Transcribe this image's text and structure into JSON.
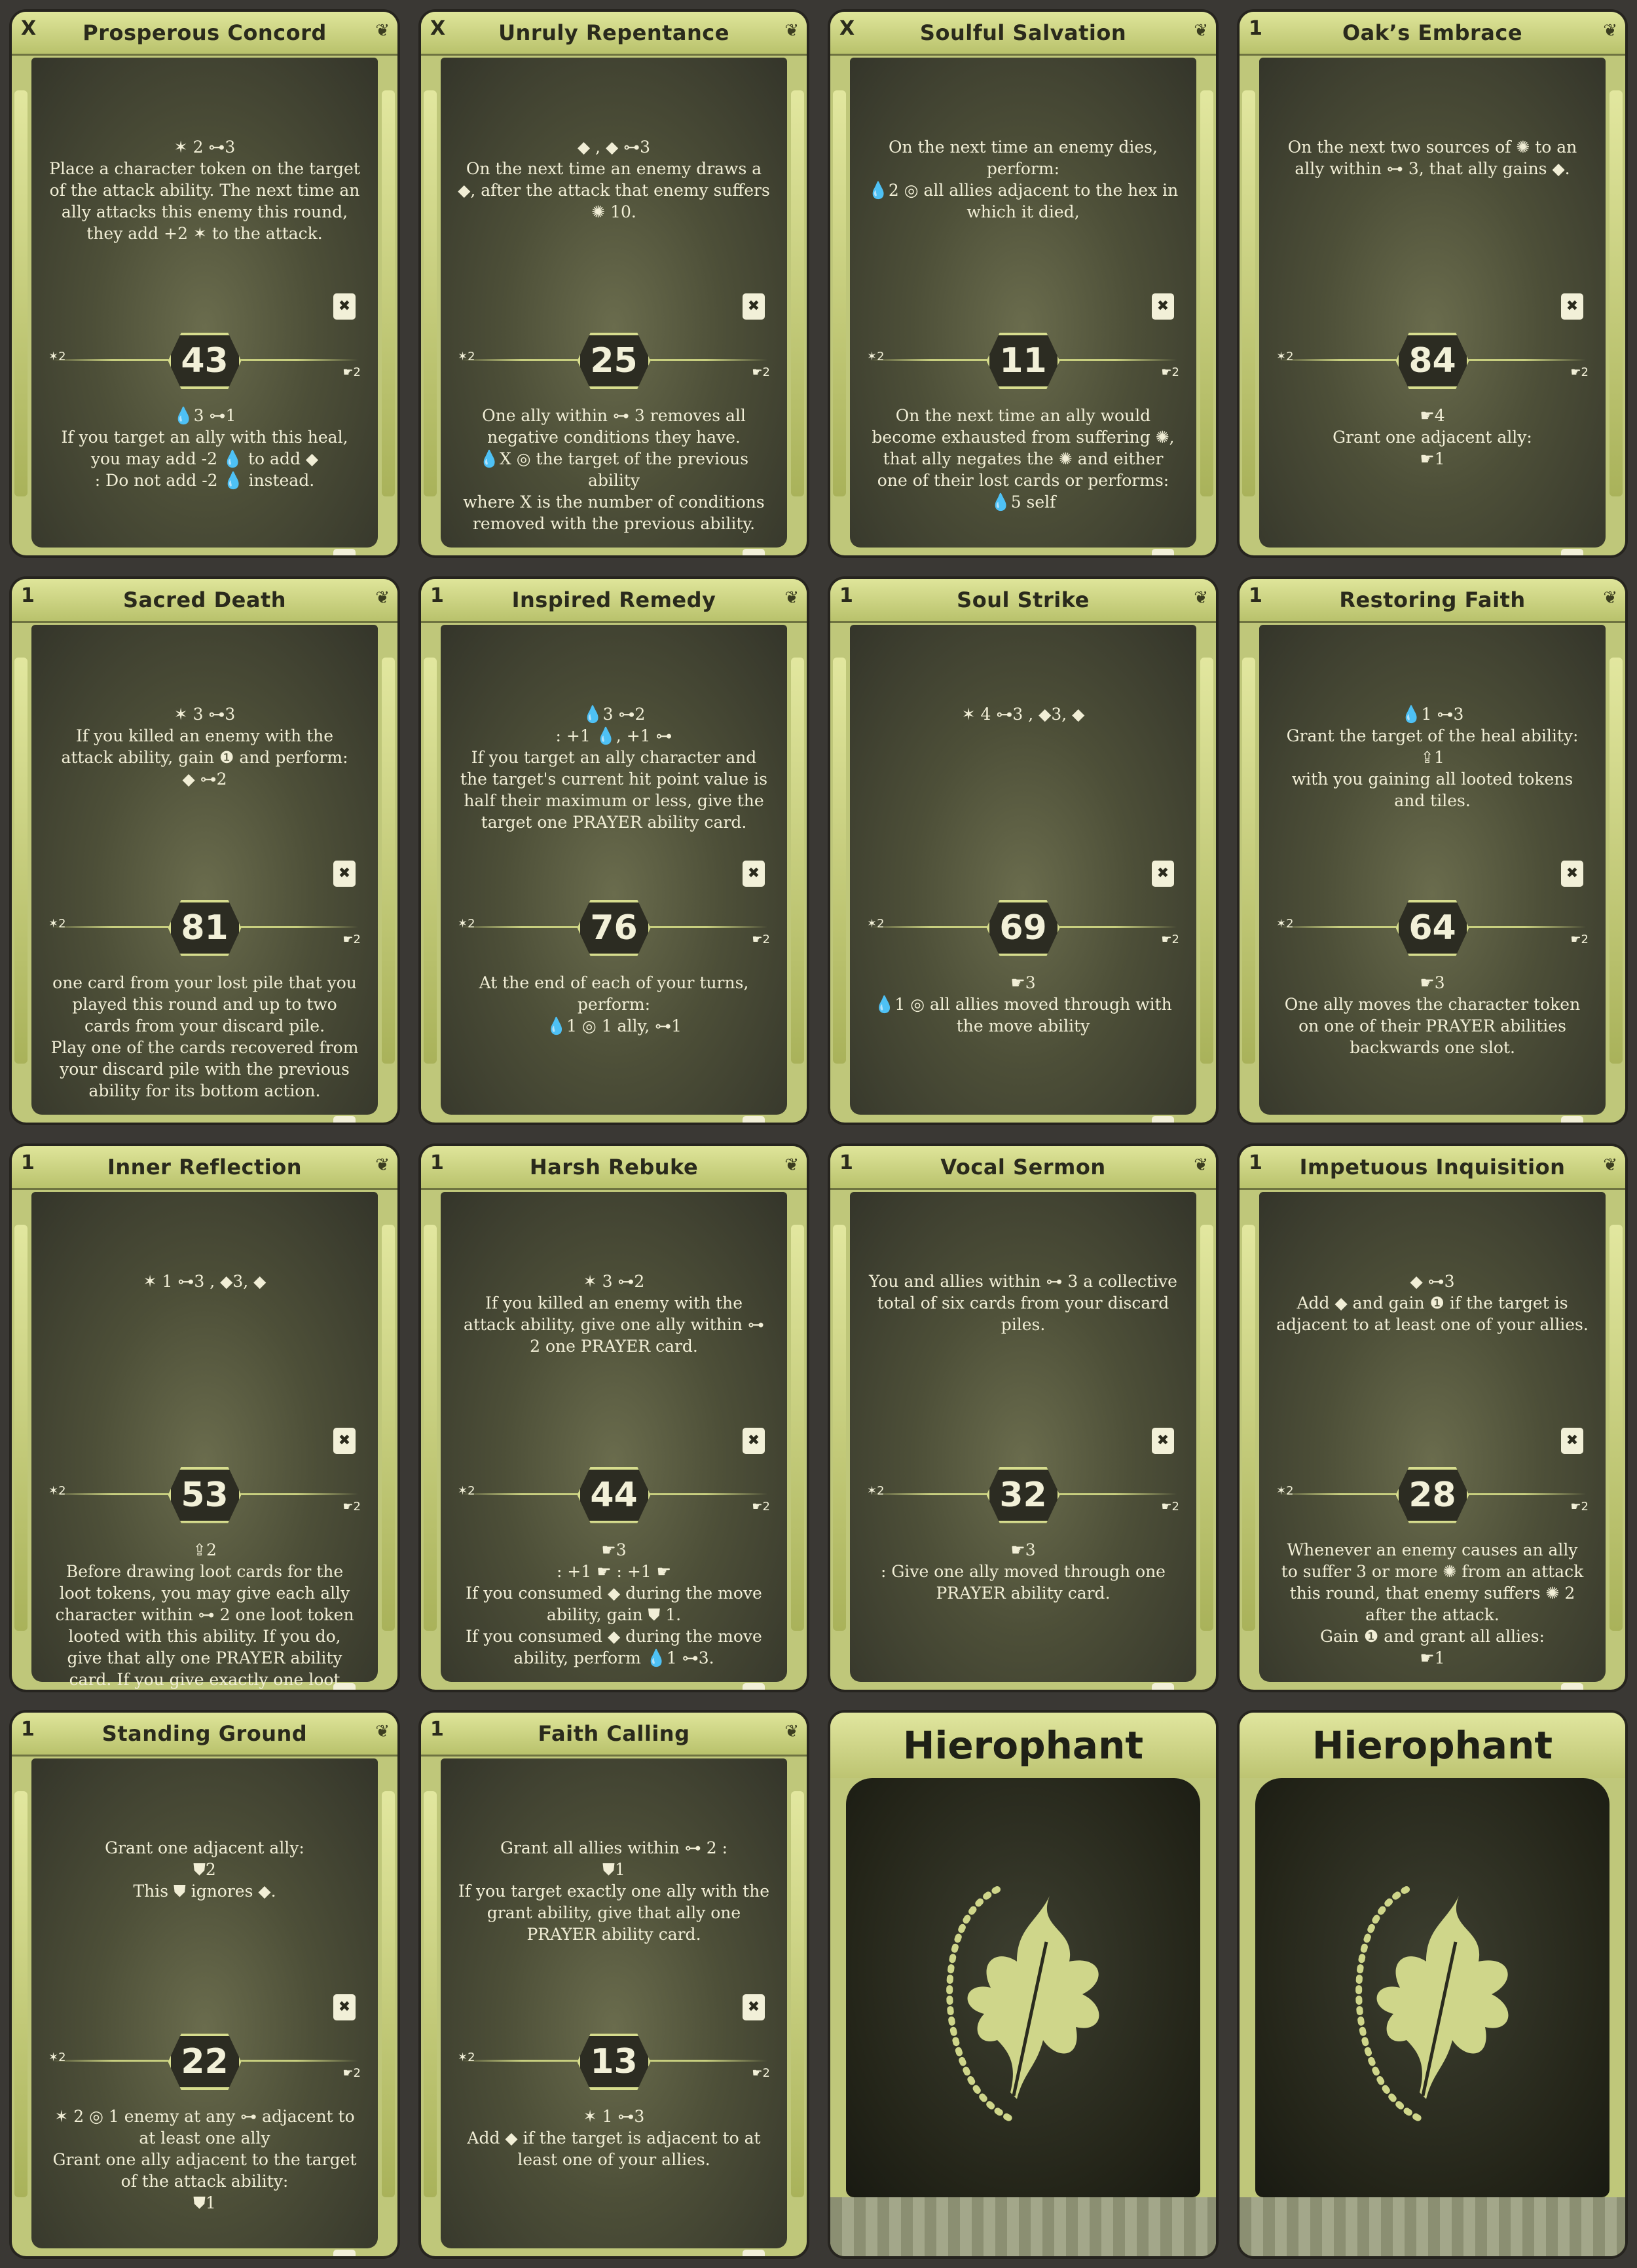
{
  "colors": {
    "card_frame": "#bfc77a",
    "card_field": "#4d4f38",
    "text": "#f1eed6",
    "prayer_highlight": "#e8d35a"
  },
  "cards": [
    {
      "level": "X",
      "title": "Prosperous Concord",
      "initiative": "43",
      "top": "✶ 2  ⊶3\nPlace a character token on the target of the attack ability. The next time an ally attacks this enemy this round, they add +2 ✶ to the attack.",
      "bottom": "💧3  ⊶1\nIf you target an ally with this heal, you may add -2 💧 to add ◆\n: Do not add -2 💧 instead."
    },
    {
      "level": "X",
      "title": "Unruly Repentance",
      "initiative": "25",
      "top": "◆ , ◆  ⊶3\nOn the next time an enemy draws a ◆, after the attack that enemy suffers ✺ 10.",
      "bottom": "One ally within ⊶ 3 removes all negative conditions they have.\n💧X  ◎ the target of the previous ability\nwhere X is the number of conditions removed with the previous ability."
    },
    {
      "level": "X",
      "title": "Soulful Salvation",
      "initiative": "11",
      "top": "On the next time an enemy dies, perform:\n💧2  ◎ all allies adjacent to the hex in which it died,",
      "bottom": "On the next time an ally would become exhausted from suffering ✺, that ally negates the ✺ and either one of their lost cards or performs:\n💧5  self"
    },
    {
      "level": "1",
      "title": "Oak’s Embrace",
      "initiative": "84",
      "top": "On the next two sources of ✺ to an ally within ⊶ 3, that ally gains ◆.",
      "bottom": "☛4\nGrant one adjacent ally:\n☛1"
    },
    {
      "level": "1",
      "title": "Sacred Death",
      "initiative": "81",
      "top": "✶ 3  ⊶3\nIf you killed an enemy with the attack ability, gain ❶ and perform:\n◆ ⊶2",
      "bottom": "one card from your lost pile that you played this round and up to two cards from your discard pile.\nPlay one of the cards recovered from your discard pile with the previous ability for its bottom action."
    },
    {
      "level": "1",
      "title": "Inspired Remedy",
      "initiative": "76",
      "top": "💧3  ⊶2\n: +1 💧, +1 ⊶\nIf you target an ally character and the target's current hit point value is half their maximum or less, give the target one PRAYER ability card.",
      "bottom": "At the end of each of your turns, perform:\n💧1  ◎ 1 ally, ⊶1"
    },
    {
      "level": "1",
      "title": "Soul Strike",
      "initiative": "69",
      "top": "✶ 4  ⊶3 , ◆3, ◆",
      "bottom": "☛3\n💧1  ◎ all allies moved through with the move ability"
    },
    {
      "level": "1",
      "title": "Restoring Faith",
      "initiative": "64",
      "top": "💧1  ⊶3\nGrant the target of the heal ability:\n⇪1\nwith you gaining all looted tokens and tiles.",
      "bottom": "☛3\nOne ally moves the character token on one of their PRAYER abilities backwards one slot."
    },
    {
      "level": "1",
      "title": "Inner Reflection",
      "initiative": "53",
      "top": "✶ 1  ⊶3 , ◆3, ◆",
      "bottom": "⇪2\nBefore drawing loot cards for the loot tokens, you may give each ally character within ⊶ 2 one loot token looted with this ability. If you do, give that ally one PRAYER ability card. If you give exactly one loot token this way, give that ally one additional PRAYER ability card."
    },
    {
      "level": "1",
      "title": "Harsh Rebuke",
      "initiative": "44",
      "top": "✶ 3  ⊶2\nIf you killed an enemy with the attack ability, give one ally within ⊶ 2 one PRAYER card.",
      "bottom": "☛3\n: +1 ☛   : +1 ☛\nIf you consumed ◆ during the move ability, gain ⛊ 1.\nIf you consumed ◆ during the move ability, perform 💧1 ⊶3."
    },
    {
      "level": "1",
      "title": "Vocal Sermon",
      "initiative": "32",
      "top": "You and allies within ⊶ 3 a collective total of six cards from your discard piles.",
      "bottom": "☛3\n: Give one ally moved through one PRAYER ability card."
    },
    {
      "level": "1",
      "title": "Impetuous Inquisition",
      "initiative": "28",
      "top": "◆  ⊶3\nAdd ◆ and gain ❶ if the target is adjacent to at least one of your allies.",
      "bottom": "Whenever an enemy causes an ally to suffer 3 or more ✺ from an attack this round, that enemy suffers ✺ 2 after the attack.\nGain ❶ and grant all allies:\n☛1"
    },
    {
      "level": "1",
      "title": "Standing Ground",
      "initiative": "22",
      "top": "Grant one adjacent ally:\n⛊2\nThis ⛊ ignores ◆.",
      "bottom": "✶ 2  ◎ 1 enemy at any ⊶ adjacent to at least one ally\nGrant one ally adjacent to the target of the attack ability:\n⛊1"
    },
    {
      "level": "1",
      "title": "Faith Calling",
      "initiative": "13",
      "top": "Grant all allies within ⊶ 2 :\n⛊1\nIf you target exactly one ally with the grant ability, give that ally one PRAYER ability card.",
      "bottom": "✶ 1  ⊶3\nAdd ◆ if the target is adjacent to at least one of your allies."
    }
  ],
  "card_backs": [
    {
      "title": "Hierophant"
    },
    {
      "title": "Hierophant"
    }
  ]
}
